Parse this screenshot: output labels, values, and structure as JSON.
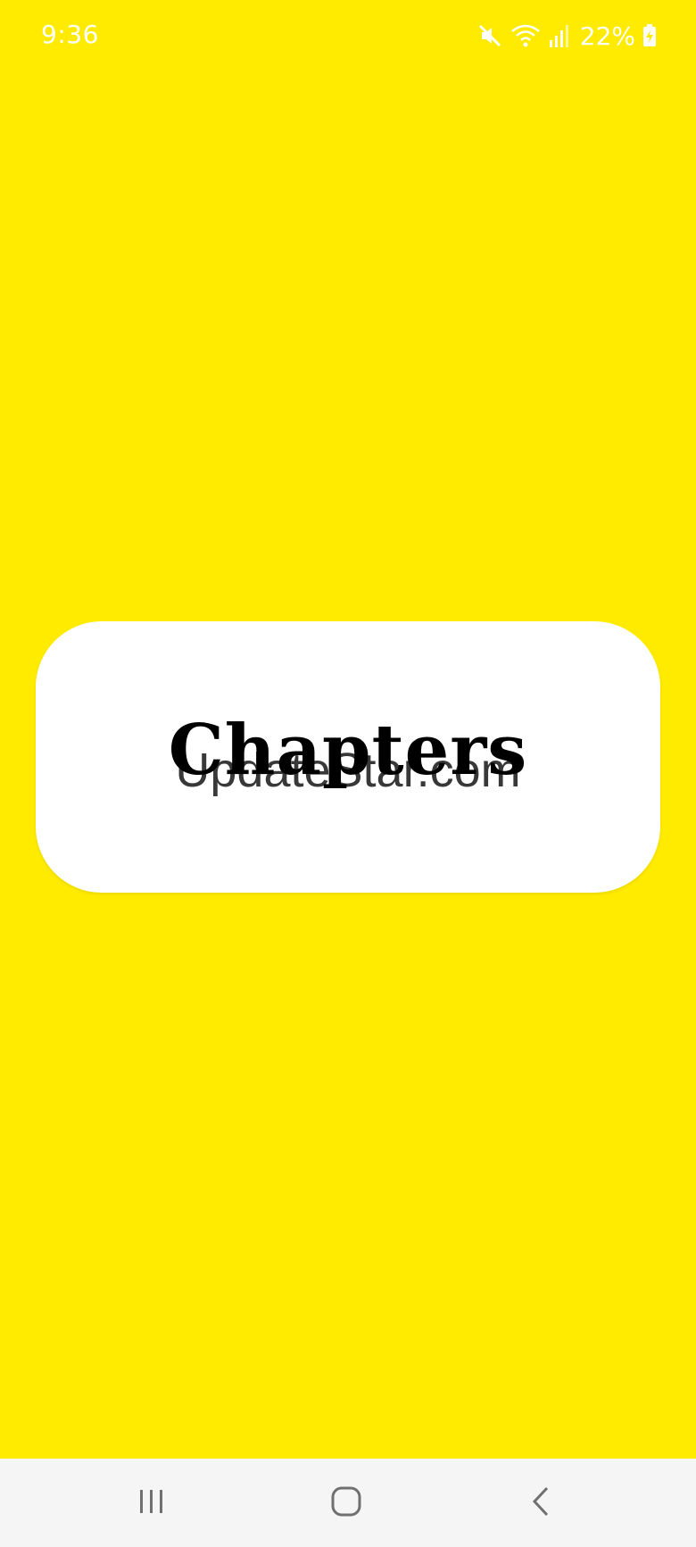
{
  "status_bar": {
    "time": "9:36",
    "battery": "22%",
    "icons": [
      "mute-icon",
      "wifi-icon",
      "signal-icon",
      "battery-charging-icon"
    ]
  },
  "main": {
    "title": "Chapters",
    "watermark": "UpdateStar.com"
  },
  "nav_bar": {
    "icons": [
      "recents-icon",
      "home-icon",
      "back-icon"
    ]
  },
  "colors": {
    "background": "#FFEB00",
    "card": "#FFFFFF",
    "title": "#000000",
    "nav_bar": "#F5F5F5"
  }
}
